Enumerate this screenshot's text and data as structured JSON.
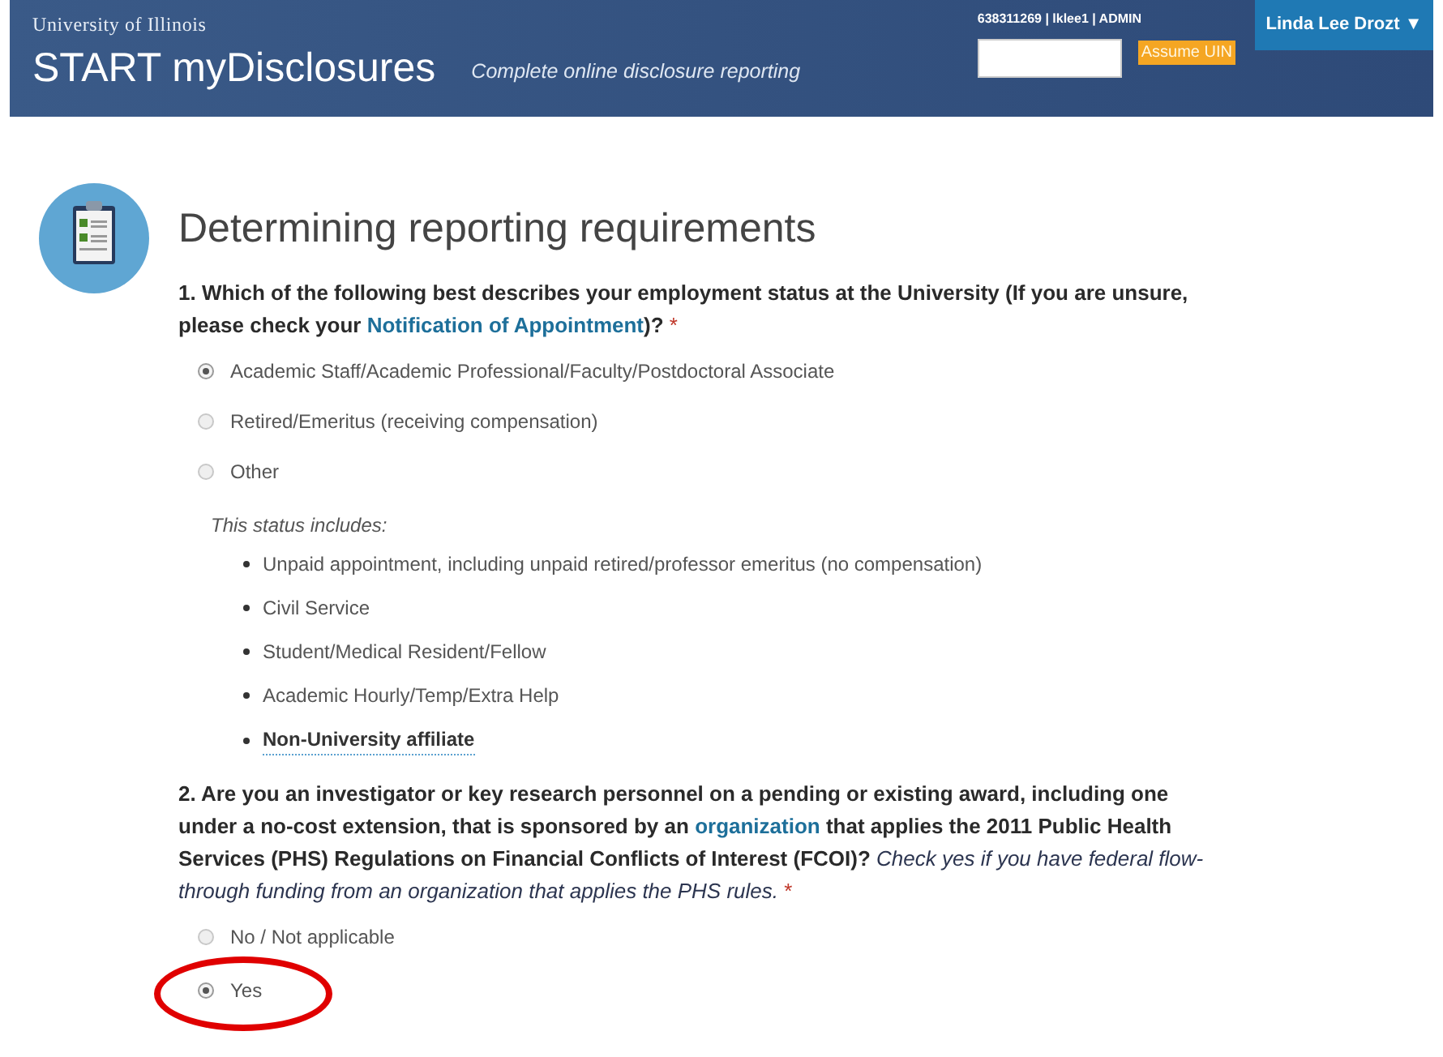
{
  "header": {
    "university": "University of Illinois",
    "app_title": "START myDisclosures",
    "tagline": "Complete online disclosure reporting",
    "session_info": "638311269 | lklee1 | ADMIN",
    "assume_button": "Assume UIN",
    "user_menu": "Linda Lee Drozt ▼"
  },
  "page_title": "Determining reporting requirements",
  "questions": [
    {
      "text_before": "1. Which of the following best describes your employment status at the University (If you are unsure, please check your ",
      "link": "Notification of Appointment",
      "text_after": ")?",
      "required": "*",
      "options": [
        {
          "label": "Academic Staff/Academic Professional/Faculty/Postdoctoral Associate",
          "selected": true
        },
        {
          "label": "Retired/Emeritus (receiving compensation)",
          "selected": false
        },
        {
          "label": "Other",
          "selected": false
        }
      ],
      "includes": {
        "caption": "This status includes:",
        "items": [
          {
            "label": "Unpaid appointment, including unpaid retired/professor emeritus (no compensation)",
            "kind": "plain"
          },
          {
            "label": "Civil Service",
            "kind": "plain"
          },
          {
            "label": "Student/Medical Resident/Fellow",
            "kind": "plain"
          },
          {
            "label": "Academic Hourly/Temp/Extra Help",
            "kind": "plain"
          },
          {
            "label": "Non-University affiliate",
            "kind": "term"
          }
        ]
      }
    },
    {
      "text_before": "2. Are you an investigator or key research personnel on a pending or existing award, including one under a no-cost extension, that is sponsored by an ",
      "link": "organization",
      "text_after": " that applies the 2011 Public Health Services (PHS) Regulations on Financial Conflicts of Interest (FCOI)?",
      "note": "Check yes if you have federal flow-through funding from an organization that applies the PHS rules.",
      "required": "*",
      "options": [
        {
          "label": "No / Not applicable",
          "selected": false
        },
        {
          "label": "Yes",
          "selected": true,
          "circled": true
        }
      ]
    }
  ]
}
